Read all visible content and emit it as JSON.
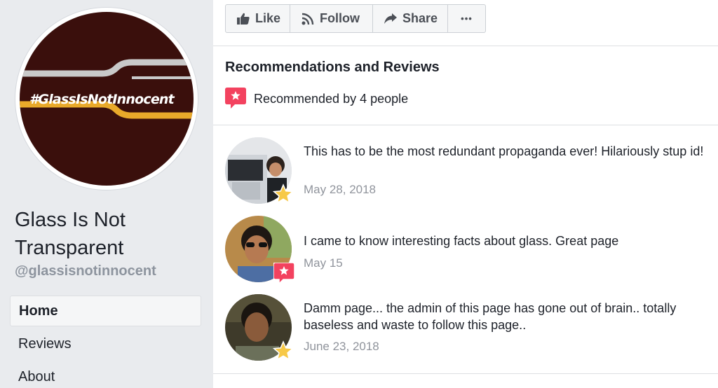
{
  "profile": {
    "hashtag": "#GlassIsNotInnocent",
    "name": "Glass Is Not Transparent",
    "handle": "@glassisnotinnocent"
  },
  "nav": {
    "items": [
      {
        "label": "Home",
        "active": true
      },
      {
        "label": "Reviews",
        "active": false
      },
      {
        "label": "About",
        "active": false
      }
    ]
  },
  "actions": {
    "like": "Like",
    "follow": "Follow",
    "share": "Share",
    "more": "•••"
  },
  "recommendations": {
    "title": "Recommendations and Reviews",
    "summary": "Recommended by 4 people"
  },
  "reviews": [
    {
      "text": "This has to be the most redundant propaganda ever! Hilariously stup id!",
      "date": "May 28, 2018",
      "badge": "star-icon"
    },
    {
      "text": "I came to know interesting facts about glass. Great page",
      "date": "May 15",
      "badge": "recommend-icon"
    },
    {
      "text": "Damm page... the admin of this page has gone out of brain..  totally baseless and waste to follow this page..",
      "date": "June 23, 2018",
      "badge": "star-icon"
    }
  ],
  "colors": {
    "accent_red": "#f3425f",
    "star_gold": "#f7c948",
    "profile_bg": "#3a0f0c"
  }
}
